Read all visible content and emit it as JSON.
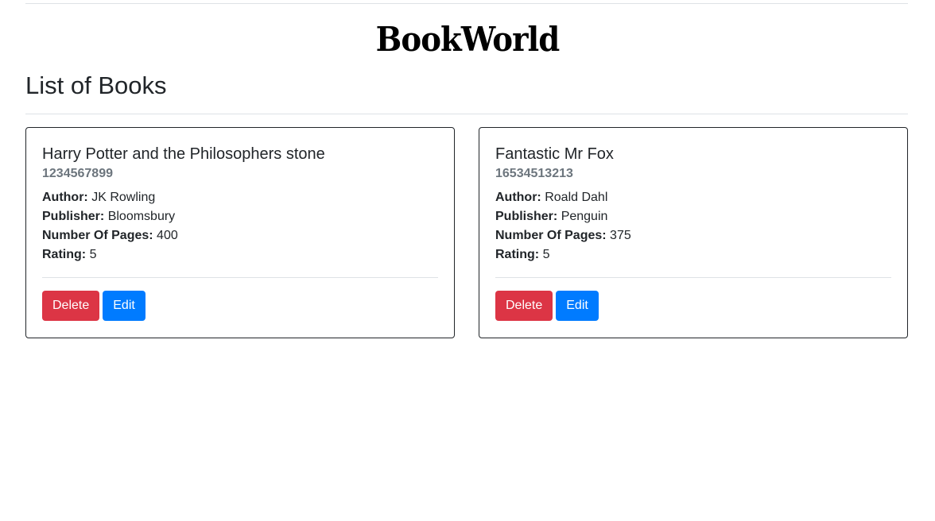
{
  "header": {
    "logo_text": "BookWorld"
  },
  "page": {
    "title": "List of Books"
  },
  "labels": {
    "author": "Author:",
    "publisher": "Publisher:",
    "pages": "Number Of Pages:",
    "rating": "Rating:"
  },
  "books": [
    {
      "title": "Harry Potter and the Philosophers stone",
      "isbn": "1234567899",
      "author": "JK Rowling",
      "publisher": "Bloomsbury",
      "pages": "400",
      "rating": "5",
      "delete_label": "Delete",
      "edit_label": "Edit"
    },
    {
      "title": "Fantastic Mr Fox",
      "isbn": "16534513213",
      "author": "Roald Dahl",
      "publisher": "Penguin",
      "pages": "375",
      "rating": "5",
      "delete_label": "Delete",
      "edit_label": "Edit"
    }
  ],
  "colors": {
    "danger": "#dc3545",
    "primary": "#007bff",
    "muted": "#6c757d"
  }
}
